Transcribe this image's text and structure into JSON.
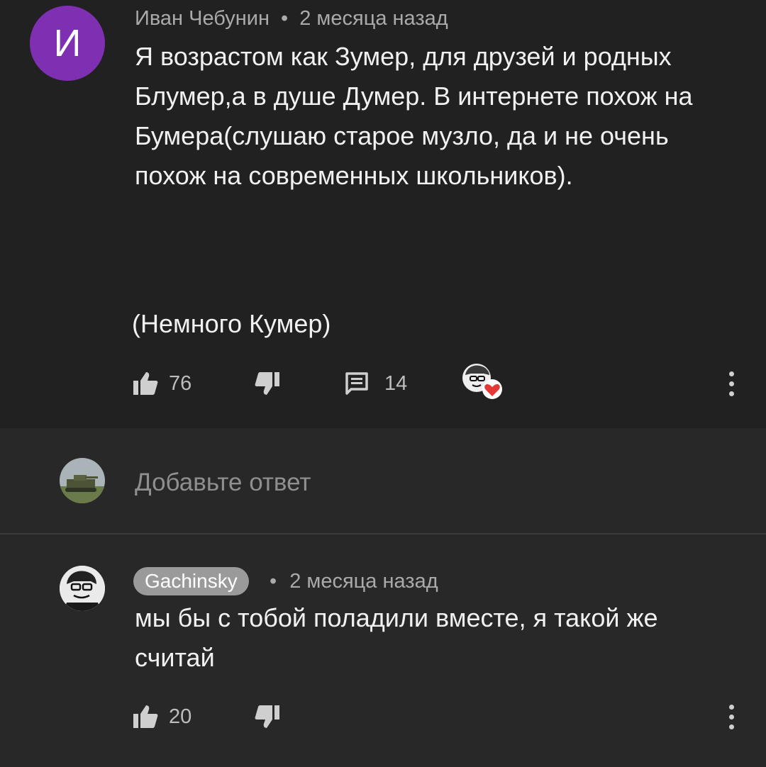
{
  "comment1": {
    "avatar_letter": "И",
    "author": "Иван Чебунин",
    "separator": "•",
    "time": "2 месяца назад",
    "text_lines": [
      "Я возрастом как Зумер, для друзей и родных",
      "Блумер,а в душе Думер. В интернете похож на",
      "Бумера(слушаю старое музло, да и не очень",
      "похож на современных школьников)."
    ],
    "text_extra": "(Немного Кумер)",
    "likes": "76",
    "replies": "14",
    "icons": {
      "like": "thumb-up-icon",
      "dislike": "thumb-down-icon",
      "reply": "comment-icon",
      "hearted": "creator-heart-icon",
      "menu": "more-vert-icon"
    },
    "avatar_color": "#7e2fb2",
    "heart_color": "#e53935"
  },
  "reply_box": {
    "placeholder": "Добавьте ответ"
  },
  "comment2": {
    "author": "Gachinsky",
    "separator": "•",
    "time": "2 месяца назад",
    "text_lines": [
      "мы бы с тобой поладили вместе, я такой же",
      "считай"
    ],
    "likes": "20",
    "icons": {
      "like": "thumb-up-icon",
      "dislike": "thumb-down-icon",
      "menu": "more-vert-icon"
    }
  }
}
